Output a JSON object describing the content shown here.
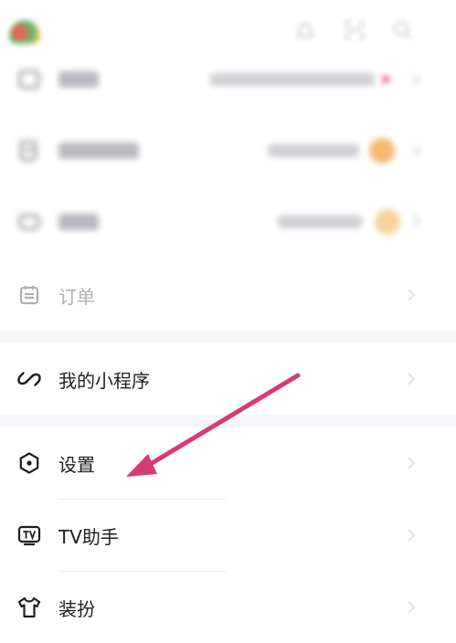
{
  "icons": {
    "top_bell": "bell-icon",
    "top_scan": "scan-icon",
    "top_search": "search-icon"
  },
  "blurred_rows": [
    {
      "name": "row-blurred-1",
      "badge_color": "#e84f6a"
    },
    {
      "name": "row-blurred-2",
      "coin_color": "#f5b970"
    },
    {
      "name": "row-blurred-3",
      "coin_color": "#f5d39a"
    }
  ],
  "menu": {
    "orders": {
      "label": "订单",
      "icon": "calendar-icon"
    },
    "mini_programs": {
      "label": "我的小程序",
      "icon": "link-icon"
    },
    "settings": {
      "label": "设置",
      "icon": "hexagon-icon"
    },
    "tv": {
      "label": "TV助手",
      "icon": "tv-icon"
    },
    "dressup": {
      "label": "装扮",
      "icon": "shirt-icon"
    }
  },
  "annotation": {
    "color": "#d63b78",
    "points_to": "settings"
  }
}
